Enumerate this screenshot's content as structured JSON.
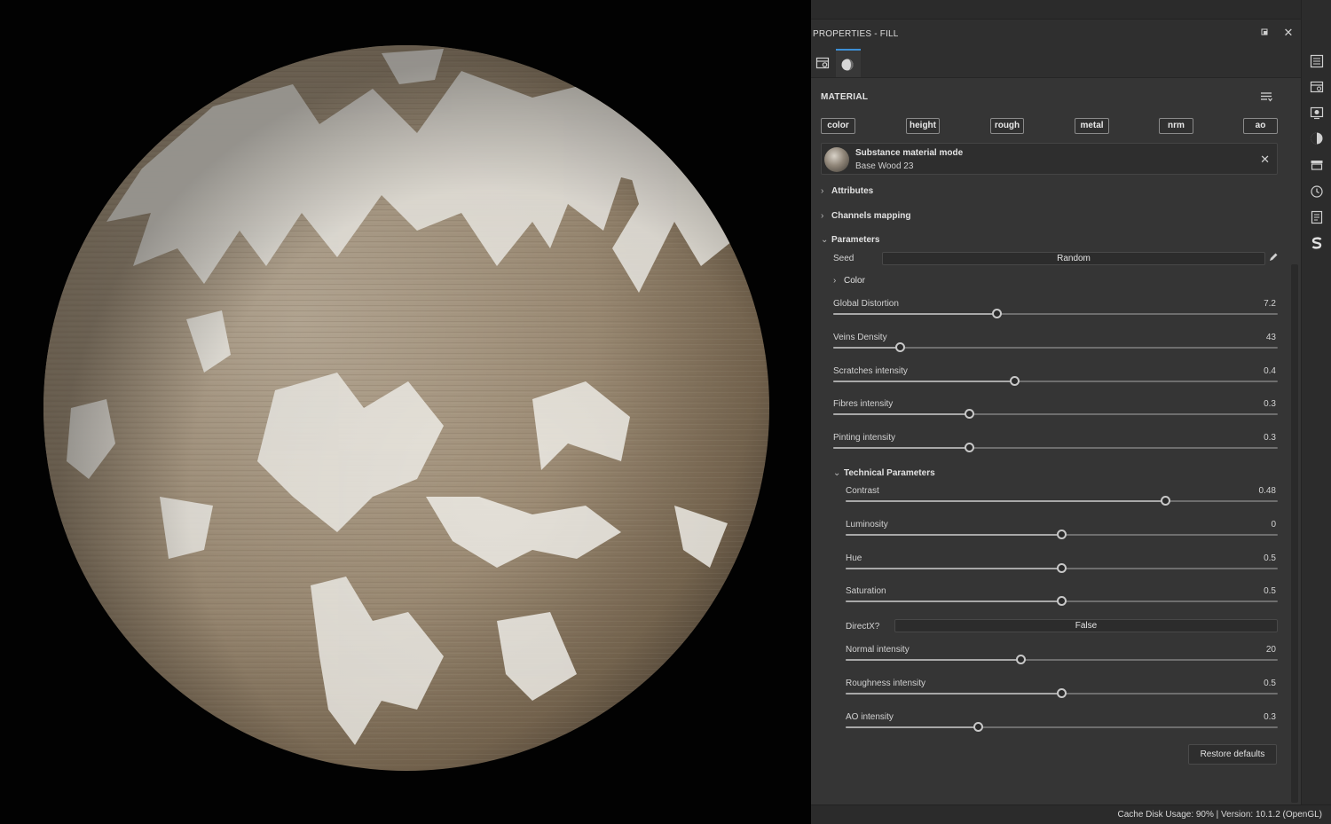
{
  "panel": {
    "title": "PROPERTIES - FILL",
    "tabs": [
      {
        "name": "layer-settings-tab",
        "icon": "layer-settings-icon"
      },
      {
        "name": "material-tab",
        "icon": "material-sphere-icon",
        "active": true
      }
    ]
  },
  "material": {
    "label": "MATERIAL",
    "channels": [
      "color",
      "height",
      "rough",
      "metal",
      "nrm",
      "ao"
    ],
    "card": {
      "mode": "Substance material mode",
      "name": "Base Wood 23"
    }
  },
  "sections": {
    "attributes": "Attributes",
    "channels_mapping": "Channels mapping",
    "parameters": "Parameters",
    "color": "Color",
    "technical": "Technical Parameters"
  },
  "seed": {
    "label": "Seed",
    "value": "Random"
  },
  "params": [
    {
      "label": "Global Distortion",
      "value": "7.2",
      "level": 0.368
    },
    {
      "label": "Veins Density",
      "value": "43",
      "level": 0.15
    },
    {
      "label": "Scratches intensity",
      "value": "0.4",
      "level": 0.408
    },
    {
      "label": "Fibres intensity",
      "value": "0.3",
      "level": 0.307
    },
    {
      "label": "Pinting intensity",
      "value": "0.3",
      "level": 0.307
    }
  ],
  "technical": [
    {
      "label": "Contrast",
      "value": "0.48",
      "level": 0.74
    },
    {
      "label": "Luminosity",
      "value": "0",
      "level": 0.5
    },
    {
      "label": "Hue",
      "value": "0.5",
      "level": 0.5
    },
    {
      "label": "Saturation",
      "value": "0.5",
      "level": 0.5
    }
  ],
  "directx": {
    "label": "DirectX?",
    "value": "False"
  },
  "technical2": [
    {
      "label": "Normal intensity",
      "value": "20",
      "level": 0.405
    },
    {
      "label": "Roughness intensity",
      "value": "0.5",
      "level": 0.5
    },
    {
      "label": "AO intensity",
      "value": "0.3",
      "level": 0.307
    }
  ],
  "restore_label": "Restore defaults",
  "status": "Cache Disk Usage:   90% | Version: 10.1.2 (OpenGL)",
  "right_toolbar": [
    "layers-icon",
    "texture-set-icon",
    "display-settings-icon",
    "shader-settings-icon",
    "bakers-icon",
    "history-icon",
    "log-icon",
    "substance-icon"
  ]
}
